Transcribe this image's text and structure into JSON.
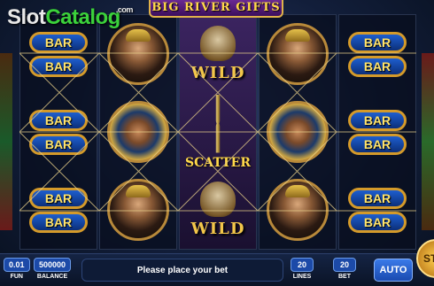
{
  "game_title": "BIG RIVER GIFTS",
  "watermark": {
    "prefix": "Slot",
    "suffix": "Catalog",
    "domain": ".com"
  },
  "reels": [
    {
      "top": {
        "type": "bar-stack",
        "labels": [
          "BAR",
          "BAR"
        ]
      },
      "middle": {
        "type": "bar-stack",
        "labels": [
          "BAR",
          "BAR"
        ]
      },
      "bottom": {
        "type": "bar-stack",
        "labels": [
          "BAR",
          "BAR"
        ]
      }
    },
    {
      "top": {
        "type": "queen"
      },
      "middle": {
        "type": "pharaoh"
      },
      "bottom": {
        "type": "queen"
      }
    },
    {
      "top": {
        "type": "wild",
        "label": "WILD"
      },
      "middle": {
        "type": "scatter",
        "label": "SCATTER"
      },
      "bottom": {
        "type": "wild",
        "label": "WILD"
      }
    },
    {
      "top": {
        "type": "queen"
      },
      "middle": {
        "type": "pharaoh"
      },
      "bottom": {
        "type": "queen"
      }
    },
    {
      "top": {
        "type": "bar-stack",
        "labels": [
          "BAR",
          "BAR"
        ]
      },
      "middle": {
        "type": "bar-stack",
        "labels": [
          "BAR",
          "BAR"
        ]
      },
      "bottom": {
        "type": "bar-stack",
        "labels": [
          "BAR",
          "BAR"
        ]
      }
    }
  ],
  "panel": {
    "fun_value": "0.01",
    "fun_label": "FUN",
    "balance_value": "500000",
    "balance_label": "BALANCE",
    "message": "Please place your bet",
    "lines_value": "20",
    "lines_label": "LINES",
    "bet_value": "20",
    "bet_label": "BET",
    "auto_label": "AUTO",
    "spin_label": "ST"
  },
  "colors": {
    "bar_fill": "#1e5ecf",
    "bar_border": "#d49a2a",
    "title_bg": "#6a2a92",
    "text_gold": "#ffd84a"
  }
}
